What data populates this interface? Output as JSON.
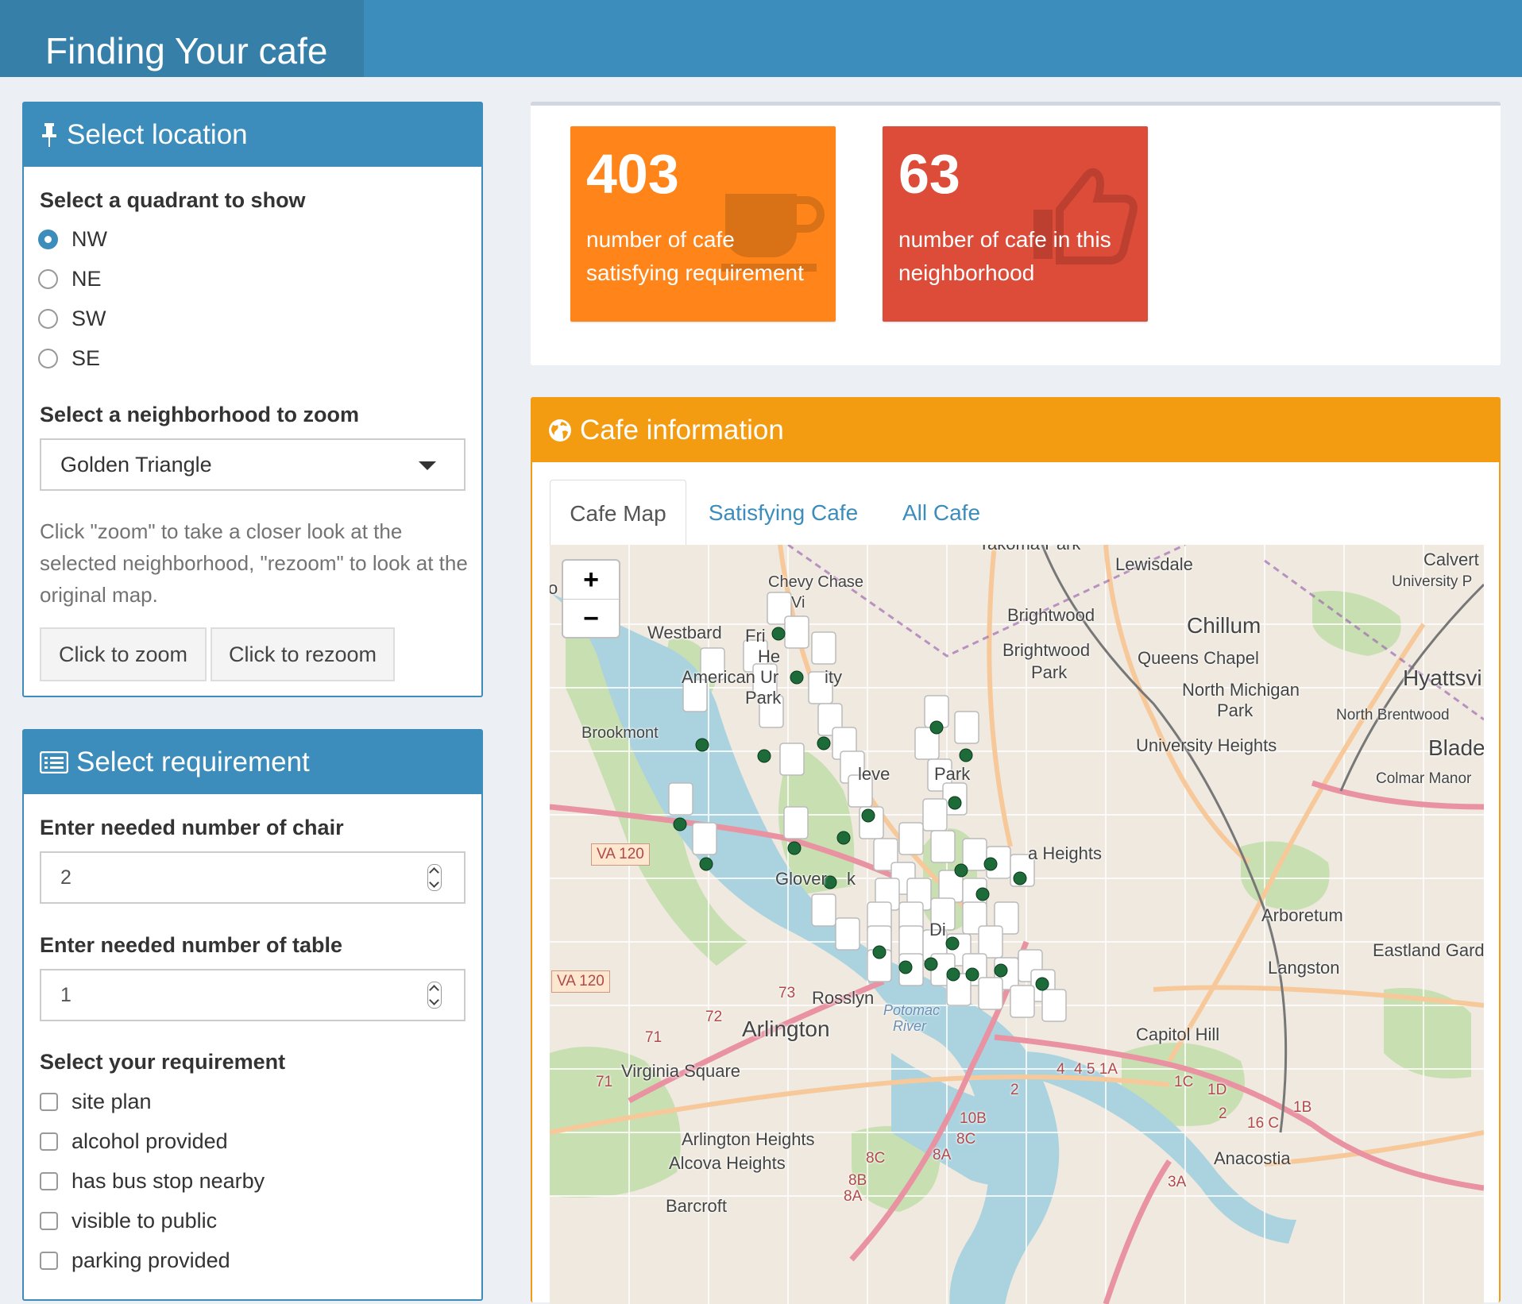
{
  "header": {
    "title": "Finding Your cafe"
  },
  "location_box": {
    "title": "Select location",
    "quadrant_label": "Select a quadrant to show",
    "quadrants": [
      {
        "label": "NW",
        "selected": true
      },
      {
        "label": "NE",
        "selected": false
      },
      {
        "label": "SW",
        "selected": false
      },
      {
        "label": "SE",
        "selected": false
      }
    ],
    "neighborhood_label": "Select a neighborhood to zoom",
    "neighborhood_value": "Golden Triangle",
    "help_text": "Click \"zoom\" to take a closer look at the selected neighborhood, \"rezoom\" to look at the original map.",
    "zoom_button": "Click to zoom",
    "rezoom_button": "Click to rezoom"
  },
  "requirement_box": {
    "title": "Select requirement",
    "chair_label": "Enter needed number of chair",
    "chair_value": "2",
    "table_label": "Enter needed number of table",
    "table_value": "1",
    "req_label": "Select your requirement",
    "options": [
      "site plan",
      "alcohol provided",
      "has bus stop nearby",
      "visible to public",
      "parking provided"
    ]
  },
  "value_boxes": [
    {
      "value": "403",
      "line1": "number of cafe",
      "line2": "satisfying requirement",
      "color": "#ff851b",
      "icon": "coffee-icon"
    },
    {
      "value": "63",
      "line1": "number of cafe in this",
      "line2": "neighborhood",
      "color": "#dd4b39",
      "icon": "thumbs-up-icon"
    }
  ],
  "cafe_box": {
    "title": "Cafe information",
    "color": "#f39c12",
    "tabs": [
      {
        "label": "Cafe Map",
        "active": true
      },
      {
        "label": "Satisfying Cafe",
        "active": false
      },
      {
        "label": "All Cafe",
        "active": false
      }
    ]
  },
  "map": {
    "zoom_in": "+",
    "zoom_out": "−",
    "labels": {
      "takoma": "Takoma Park",
      "lewisdale": "Lewisdale",
      "calverton": "Calvert",
      "university_park": "University P",
      "chevy_chase": "Chevy Chase",
      "chevy_chase_vi": "Vi",
      "brightwood": "Brightwood",
      "chillum": "Chillum",
      "westbard": "Westbard",
      "friendship": "Fri",
      "friendship2": "He",
      "brightwood_park1": "Brightwood",
      "brightwood_park2": "Park",
      "queens_chapel": "Queens Chapel",
      "american_u1": "American Ur",
      "american_u2": "ity",
      "american_u3": "Park",
      "north_michigan1": "North Michigan",
      "north_michigan2": "Park",
      "hyattsville": "Hyattsvi",
      "north_brentwood": "North Brentwood",
      "brookmont": "Brookmont",
      "university_heights": "University Heights",
      "bladensburg": "Blade",
      "cleveland1": "leve",
      "cleveland2": "Park",
      "colmar_manor": "Colmar Manor",
      "va120a": "VA 120",
      "heights": "a Heights",
      "glover": "Glover",
      "glover_k": "k",
      "arboretum": "Arboretum",
      "di": "Di",
      "eastland": "Eastland Gard",
      "va120b": "VA 120",
      "langston": "Langston",
      "r73": "73",
      "rosslyn": "Rosslyn",
      "r72": "72",
      "potomac1": "Potomac",
      "potomac2": "River",
      "arlington": "Arlington",
      "r71": "71",
      "capitol_hill": "Capitol Hill",
      "virginia_square": "Virginia Square",
      "routes_4": "4",
      "routes_45": "4 5 1A",
      "r71b": "71",
      "r1c": "1C",
      "r1d": "1D",
      "r2": "2",
      "r10b": "10B",
      "r1b": "1B",
      "r2b": "2",
      "r16c": "16 C",
      "arlington_heights": "Arlington Heights",
      "r8c": "8C",
      "r8a": "8A",
      "r8c2": "8C",
      "alcova_heights": "Alcova Heights",
      "anacostia": "Anacostia",
      "r8b": "8B",
      "r8a2": "8A",
      "r3a": "3A",
      "barcroft": "Barcroft",
      "r0": "o"
    }
  }
}
